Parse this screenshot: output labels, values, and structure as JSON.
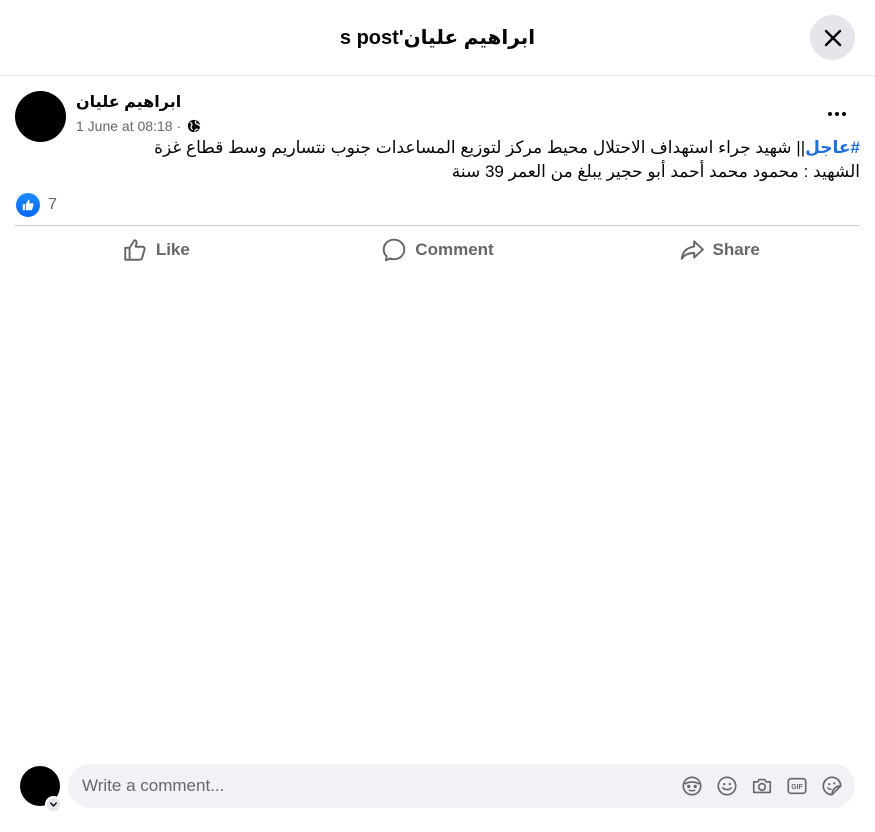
{
  "header": {
    "title": "ابراهيم عليان's post",
    "close_icon": "close-icon"
  },
  "post": {
    "author": "ابراهيم عليان",
    "date": "1 June at 08:18",
    "separator": "·",
    "privacy_icon": "globe-icon",
    "hashtag": "#عاجل",
    "line1_rest": "|| شهيد جراء استهداف الاحتلال محيط مركز لتوزيع المساعدات جنوب نتساريم وسط قطاع غزة",
    "line2": "الشهيد : محمود محمد أحمد أبو حجير يبلغ من العمر 39 سنة",
    "more_icon": "more-options-icon"
  },
  "reactions": {
    "icon": "like-reaction-icon",
    "count": "7"
  },
  "actions": {
    "like_label": "Like",
    "comment_label": "Comment",
    "share_label": "Share"
  },
  "composer": {
    "placeholder": "Write a comment...",
    "icons": [
      "avatar-sticker-icon",
      "emoji-icon",
      "camera-icon",
      "gif-icon",
      "sticker-icon"
    ]
  },
  "colors": {
    "accent": "#0866ff",
    "hashtag": "#216fdb",
    "secondary_text": "#65676b",
    "divider": "#ced0d4"
  }
}
